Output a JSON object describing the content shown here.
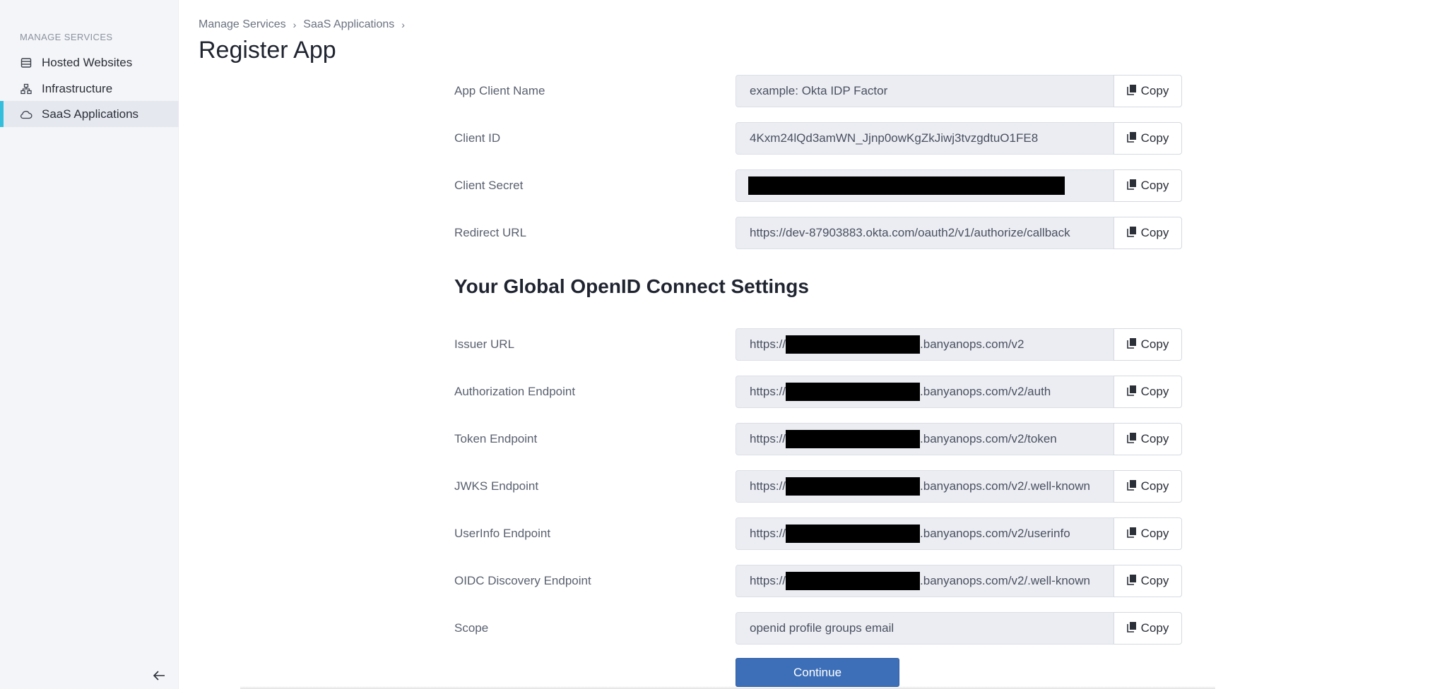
{
  "sidebar": {
    "heading": "MANAGE SERVICES",
    "items": [
      {
        "label": "Hosted Websites",
        "icon": "server-icon"
      },
      {
        "label": "Infrastructure",
        "icon": "network-icon"
      },
      {
        "label": "SaaS Applications",
        "icon": "cloud-icon",
        "active": true
      }
    ]
  },
  "breadcrumb": {
    "items": [
      "Manage Services",
      "SaaS Applications"
    ],
    "separator": "›"
  },
  "page": {
    "title": "Register App"
  },
  "app_fields": [
    {
      "label": "App Client Name",
      "value": "example: Okta IDP Factor"
    },
    {
      "label": "Client ID",
      "value": "4Kxm24lQd3amWN_Jjnp0owKgZkJiwj3tvzgdtuO1FE8"
    },
    {
      "label": "Client Secret",
      "value": ""
    },
    {
      "label": "Redirect URL",
      "value": "https://dev-87903883.okta.com/oauth2/v1/authorize/callback"
    }
  ],
  "oidc": {
    "section_title": "Your Global OpenID Connect Settings",
    "prefix": "https://",
    "fields": [
      {
        "label": "Issuer URL",
        "suffix": ".banyanops.com/v2"
      },
      {
        "label": "Authorization Endpoint",
        "suffix": ".banyanops.com/v2/auth"
      },
      {
        "label": "Token Endpoint",
        "suffix": ".banyanops.com/v2/token"
      },
      {
        "label": "JWKS Endpoint",
        "suffix": ".banyanops.com/v2/.well-known"
      },
      {
        "label": "UserInfo Endpoint",
        "suffix": ".banyanops.com/v2/userinfo"
      },
      {
        "label": "OIDC Discovery Endpoint",
        "suffix": ".banyanops.com/v2/.well-known"
      }
    ],
    "scope": {
      "label": "Scope",
      "value": "openid profile groups email"
    }
  },
  "actions": {
    "copy_label": "Copy",
    "continue_label": "Continue"
  },
  "colors": {
    "accent": "#33bfdc",
    "primary_button": "#3d6fb8"
  }
}
